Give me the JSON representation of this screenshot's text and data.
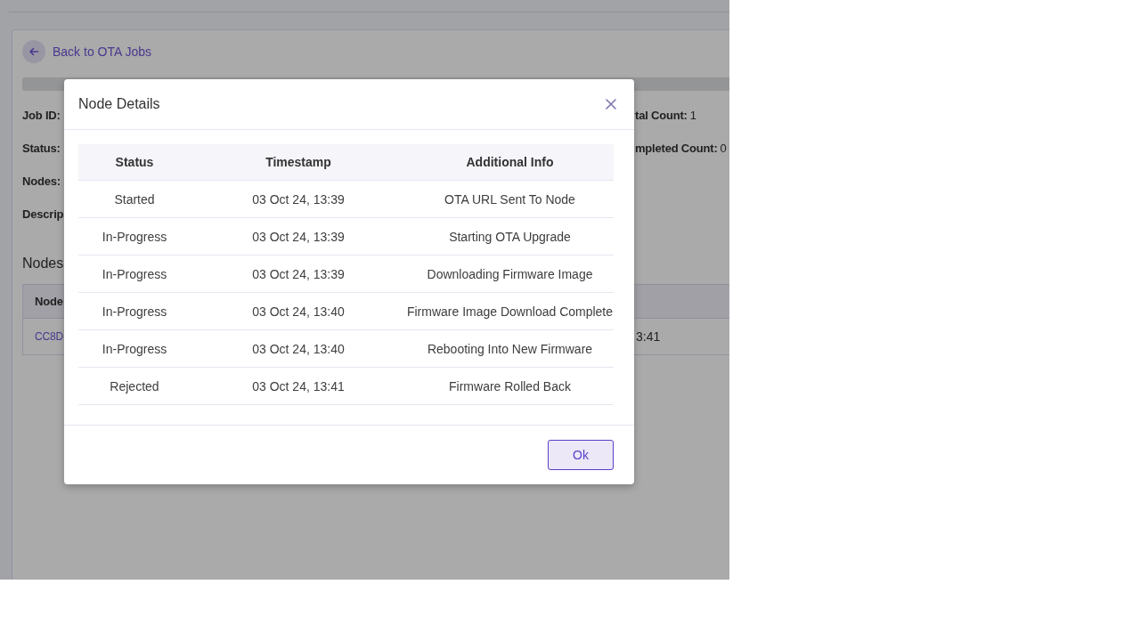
{
  "page": {
    "back_link": "Back to OTA Jobs",
    "details_left": [
      "Job ID:",
      "Status:",
      "Nodes:",
      "Descrip"
    ],
    "details_right": [
      {
        "label": "tal Count:",
        "value": "1"
      },
      {
        "label": "mpleted Count:",
        "value": "0"
      }
    ],
    "nodes_heading": "Nodes",
    "nodes_table": {
      "columns": [
        "Node"
      ],
      "rows": [
        [
          "CC8D",
          "3:41"
        ]
      ]
    }
  },
  "modal": {
    "title": "Node Details",
    "table": {
      "columns": [
        "Status",
        "Timestamp",
        "Additional Info"
      ],
      "rows": [
        {
          "status": "Started",
          "timestamp": "03 Oct 24, 13:39",
          "info": "OTA URL Sent To Node"
        },
        {
          "status": "In-Progress",
          "timestamp": "03 Oct 24, 13:39",
          "info": "Starting OTA Upgrade"
        },
        {
          "status": "In-Progress",
          "timestamp": "03 Oct 24, 13:39",
          "info": "Downloading Firmware Image"
        },
        {
          "status": "In-Progress",
          "timestamp": "03 Oct 24, 13:40",
          "info": "Firmware Image Download Complete"
        },
        {
          "status": "In-Progress",
          "timestamp": "03 Oct 24, 13:40",
          "info": "Rebooting Into New Firmware"
        },
        {
          "status": "Rejected",
          "timestamp": "03 Oct 24, 13:41",
          "info": "Firmware Rolled Back"
        }
      ]
    },
    "buttons": [
      "Ok"
    ]
  }
}
